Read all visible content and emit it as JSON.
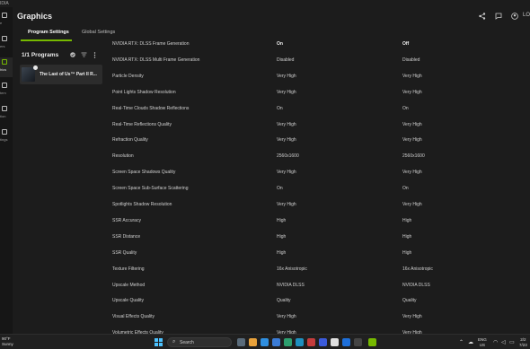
{
  "app": {
    "title_fragment": "IDIA"
  },
  "rail": [
    {
      "label": "e",
      "name": "home"
    },
    {
      "label": "ers",
      "name": "drivers"
    },
    {
      "label": "hics",
      "name": "graphics",
      "active": true
    },
    {
      "label": "tem",
      "name": "system"
    },
    {
      "label": "tion",
      "name": "redemption"
    },
    {
      "label": "tings",
      "name": "settings"
    }
  ],
  "header": {
    "title": "Graphics",
    "user": "LO"
  },
  "tabs": [
    {
      "label": "Program Settings",
      "active": true
    },
    {
      "label": "Global Settings",
      "active": false
    }
  ],
  "programs": {
    "heading": "1/1 Programs",
    "items": [
      {
        "name": "The Last of Us™ Part II R..."
      }
    ]
  },
  "settings": {
    "rows": [
      {
        "name": "NVIDIA RTX: DLSS Frame Generation",
        "current": "On",
        "recommended": "Off",
        "bold": true
      },
      {
        "name": "NVIDIA RTX: DLSS Multi Frame Generation",
        "current": "Disabled",
        "recommended": "Disabled"
      },
      {
        "name": "Particle Density",
        "current": "Very High",
        "recommended": "Very High"
      },
      {
        "name": "Point Lights Shadow Resolution",
        "current": "Very High",
        "recommended": "Very High"
      },
      {
        "name": "Real-Time Clouds Shadow Reflections",
        "current": "On",
        "recommended": "On"
      },
      {
        "name": "Real-Time Reflections Quality",
        "current": "Very High",
        "recommended": "Very High"
      },
      {
        "name": "Refraction Quality",
        "current": "Very High",
        "recommended": "Very High"
      },
      {
        "name": "Resolution",
        "current": "2560x1600",
        "recommended": "2560x1600"
      },
      {
        "name": "Screen Space Shadows Quality",
        "current": "Very High",
        "recommended": "Very High"
      },
      {
        "name": "Screen Space Sub-Surface Scattering",
        "current": "On",
        "recommended": "On"
      },
      {
        "name": "Spotlights Shadow Resolution",
        "current": "Very High",
        "recommended": "Very High"
      },
      {
        "name": "SSR Accuracy",
        "current": "High",
        "recommended": "High"
      },
      {
        "name": "SSR Distance",
        "current": "High",
        "recommended": "High"
      },
      {
        "name": "SSR Quality",
        "current": "High",
        "recommended": "High"
      },
      {
        "name": "Texture Filtering",
        "current": "16x Anisotropic",
        "recommended": "16x Anisotropic"
      },
      {
        "name": "Upscale Method",
        "current": "NVIDIA DLSS",
        "recommended": "NVIDIA DLSS"
      },
      {
        "name": "Upscale Quality",
        "current": "Quality",
        "recommended": "Quality"
      },
      {
        "name": "Visual Effects Quality",
        "current": "Very High",
        "recommended": "Very High"
      },
      {
        "name": "Volumetric Effects Quality",
        "current": "Very High",
        "recommended": "Very High"
      }
    ]
  },
  "taskbar": {
    "weather_temp": "90°F",
    "weather_desc": "Sunny",
    "search_label": "Search",
    "lang_top": "ENG",
    "lang_bottom": "US",
    "time": "2/2",
    "date": "7/23"
  },
  "colors": {
    "accent": "#76b900",
    "bg": "#1c1c1c"
  }
}
